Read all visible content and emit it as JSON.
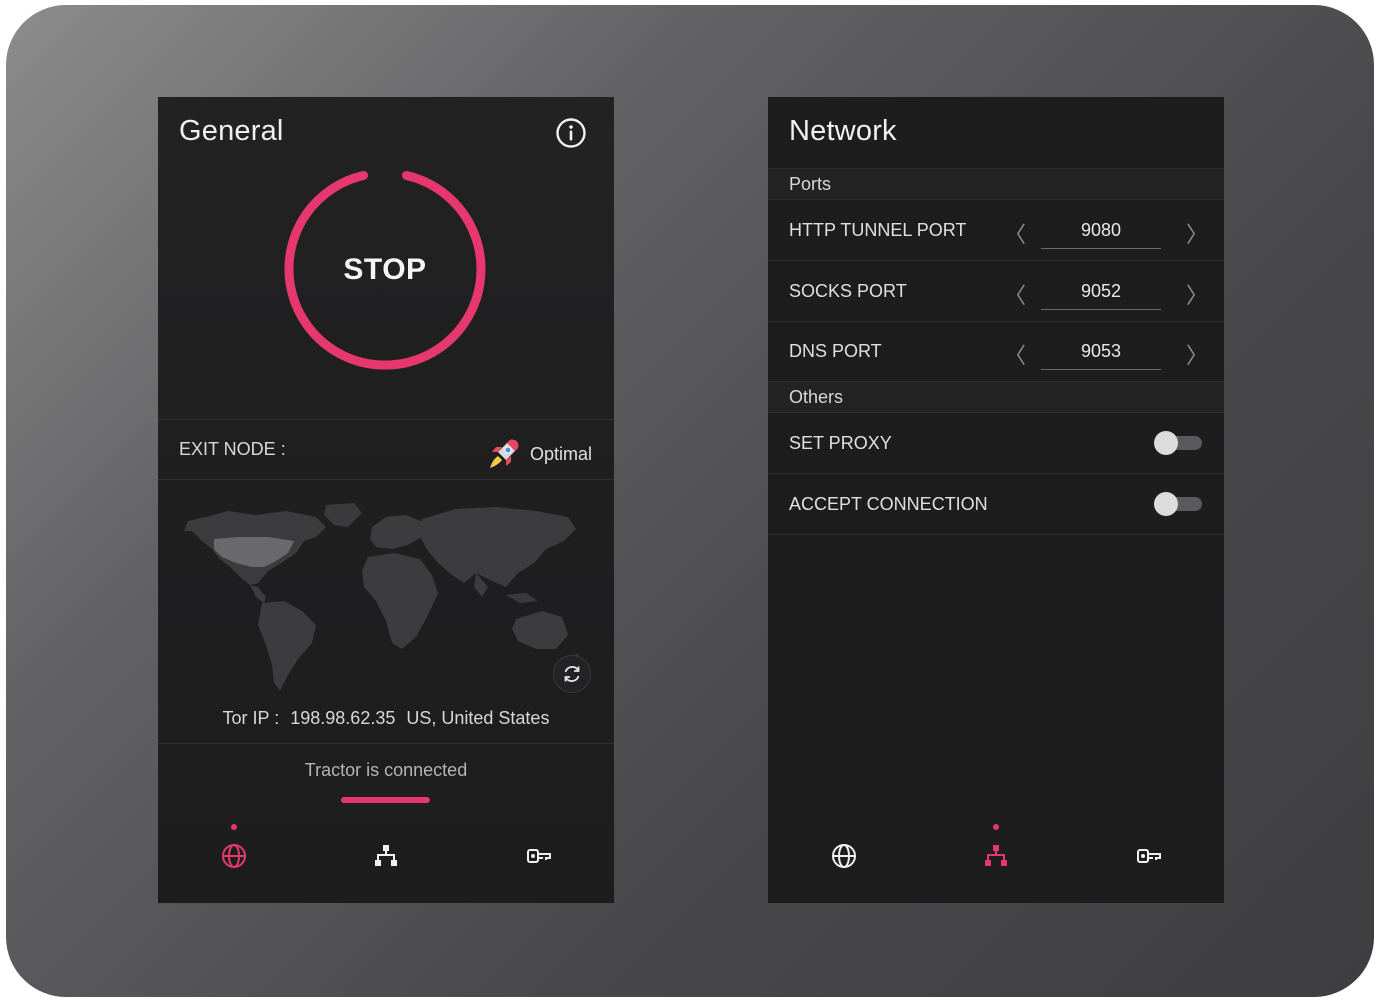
{
  "general": {
    "title": "General",
    "stop_label": "STOP",
    "exit_node_label": "EXIT NODE :",
    "exit_node_value": "Optimal",
    "tor_ip_label": "Tor IP :",
    "tor_ip_value": "198.98.62.35",
    "tor_ip_location": "US, United States",
    "status": "Tractor is connected",
    "active_tab": "globe"
  },
  "network": {
    "title": "Network",
    "ports_header": "Ports",
    "others_header": "Others",
    "ports": [
      {
        "label": "HTTP TUNNEL PORT",
        "value": "9080"
      },
      {
        "label": "SOCKS PORT",
        "value": "9052"
      },
      {
        "label": "DNS PORT",
        "value": "9053"
      }
    ],
    "toggles": [
      {
        "label": "SET PROXY",
        "on": false
      },
      {
        "label": "ACCEPT CONNECTION",
        "on": false
      }
    ],
    "active_tab": "network"
  },
  "nav_icons": [
    "globe-icon",
    "network-icon",
    "key-icon"
  ],
  "colors": {
    "accent": "#e6386e",
    "panel_bg": "#1e1e1f",
    "text": "#e6e6e6"
  }
}
